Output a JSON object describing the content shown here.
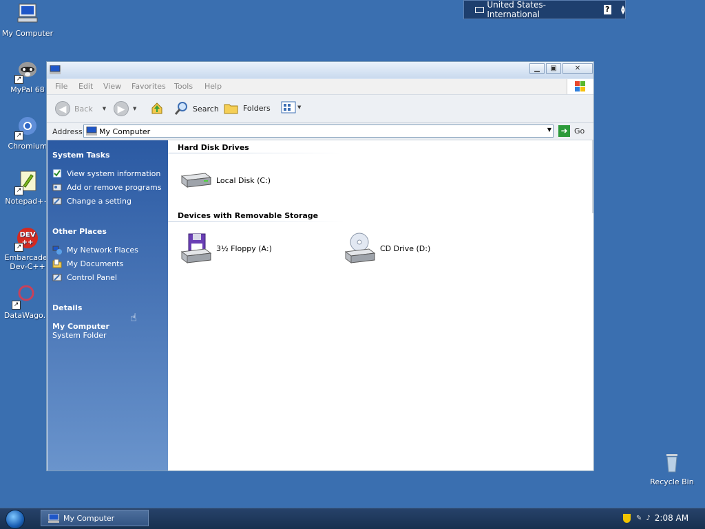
{
  "desktop": {
    "icons": [
      {
        "label": "My Computer"
      },
      {
        "label": "MyPal 68"
      },
      {
        "label": "Chromium"
      },
      {
        "label": "Notepad++"
      },
      {
        "label": "Embarcadero Dev-C++",
        "line1": "Embarcader",
        "line2": "Dev-C++"
      },
      {
        "label": "DataWago."
      },
      {
        "label": "Recycle Bin"
      }
    ]
  },
  "language_bar": {
    "text": "United States-International",
    "help": "?"
  },
  "window": {
    "menu": [
      "File",
      "Edit",
      "View",
      "Favorites",
      "Tools",
      "Help"
    ],
    "toolbar": {
      "back": "Back",
      "search": "Search",
      "folders": "Folders"
    },
    "address": {
      "label": "Address",
      "value": "My Computer",
      "go": "Go"
    },
    "left_pane": {
      "system_tasks": {
        "title": "System Tasks",
        "items": [
          "View system information",
          "Add or remove programs",
          "Change a setting"
        ]
      },
      "other_places": {
        "title": "Other Places",
        "items": [
          "My Network Places",
          "My Documents",
          "Control Panel"
        ]
      },
      "details": {
        "title": "Details",
        "name": "My Computer",
        "type": "System Folder"
      }
    },
    "groups": [
      {
        "title": "Hard Disk Drives",
        "items": [
          "Local Disk (C:)"
        ]
      },
      {
        "title": "Devices with Removable Storage",
        "items": [
          "3½ Floppy (A:)",
          "CD Drive (D:)"
        ]
      }
    ]
  },
  "taskbar": {
    "window_button": "My Computer",
    "clock": "2:08 AM"
  }
}
